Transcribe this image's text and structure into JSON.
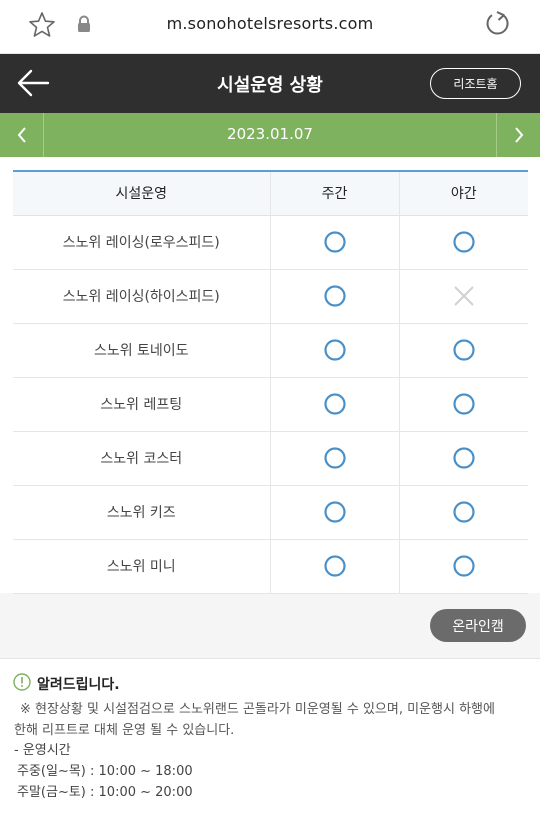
{
  "browser": {
    "url": "m.sonohotelsresorts.com"
  },
  "header": {
    "title": "시설운영 상황",
    "resort_home": "리조트홈"
  },
  "datebar": {
    "date": "2023.01.07"
  },
  "table": {
    "headers": [
      "시설운영",
      "주간",
      "야간"
    ],
    "rows": [
      {
        "name": "스노위 레이싱(로우스피드)",
        "day": "open",
        "night": "open"
      },
      {
        "name": "스노위 레이싱(하이스피드)",
        "day": "open",
        "night": "closed"
      },
      {
        "name": "스노위 토네이도",
        "day": "open",
        "night": "open"
      },
      {
        "name": "스노위 레프팅",
        "day": "open",
        "night": "open"
      },
      {
        "name": "스노위 코스터",
        "day": "open",
        "night": "open"
      },
      {
        "name": "스노위 키즈",
        "day": "open",
        "night": "open"
      },
      {
        "name": "스노위 미니",
        "day": "open",
        "night": "open"
      }
    ]
  },
  "online_cam": "온라인캠",
  "notice": {
    "title": "알려드립니다.",
    "line1": "※ 현장상황 및 시설점검으로 스노위랜드 곤돌라가 미운영될 수 있으며, 미운행시 하행에",
    "line2": "한해 리프트로 대체 운영 될 수 있습니다.",
    "hours_label": "- 운영시간",
    "weekday": "주중(일~목) : 10:00 ~ 18:00",
    "weekend": "주말(금~토) : 10:00 ~ 20:00"
  },
  "colors": {
    "header_bg": "#2f2f2f",
    "datebar_bg": "#7fb25f",
    "open_mark": "#4a90c8",
    "closed_mark": "#d0d0d0"
  }
}
